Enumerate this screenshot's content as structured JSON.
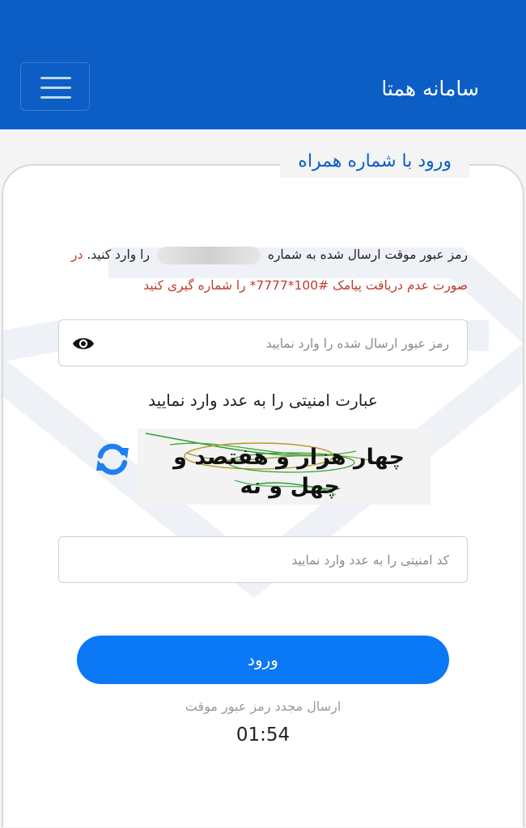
{
  "header": {
    "title": "سامانه همتا",
    "background_color": "#0c5ec4"
  },
  "menu": {
    "icon": "hamburger-menu-icon"
  },
  "login": {
    "legend": "ورود با شماره همراه",
    "info_line1_part1": "رمز عبور موقت ارسال شده به شماره",
    "info_line1_part2": "را وارد کنید.",
    "info_line1_red": "در",
    "info_line2_red": "صورت عدم دریافت پیامک #100*7777* را شماره گیری کنید",
    "password_placeholder": "رمز عبور ارسال شده را وارد نمایید",
    "eye_icon": "eye-icon",
    "security_label": "عبارت امنیتی را به عدد وارد نمایید",
    "captcha_line1": "چهار هزار و هفتصد و",
    "captcha_line2": "چهل و نه",
    "refresh_icon": "refresh-icon",
    "captcha_placeholder": "کد امنیتی را به عدد وارد نمایید",
    "submit_label": "ورود",
    "resend_label": "ارسال مجدد رمز عبور موقت",
    "timer": "01:54",
    "accent_color": "#0b78f5",
    "warning_color": "#c0392b"
  }
}
